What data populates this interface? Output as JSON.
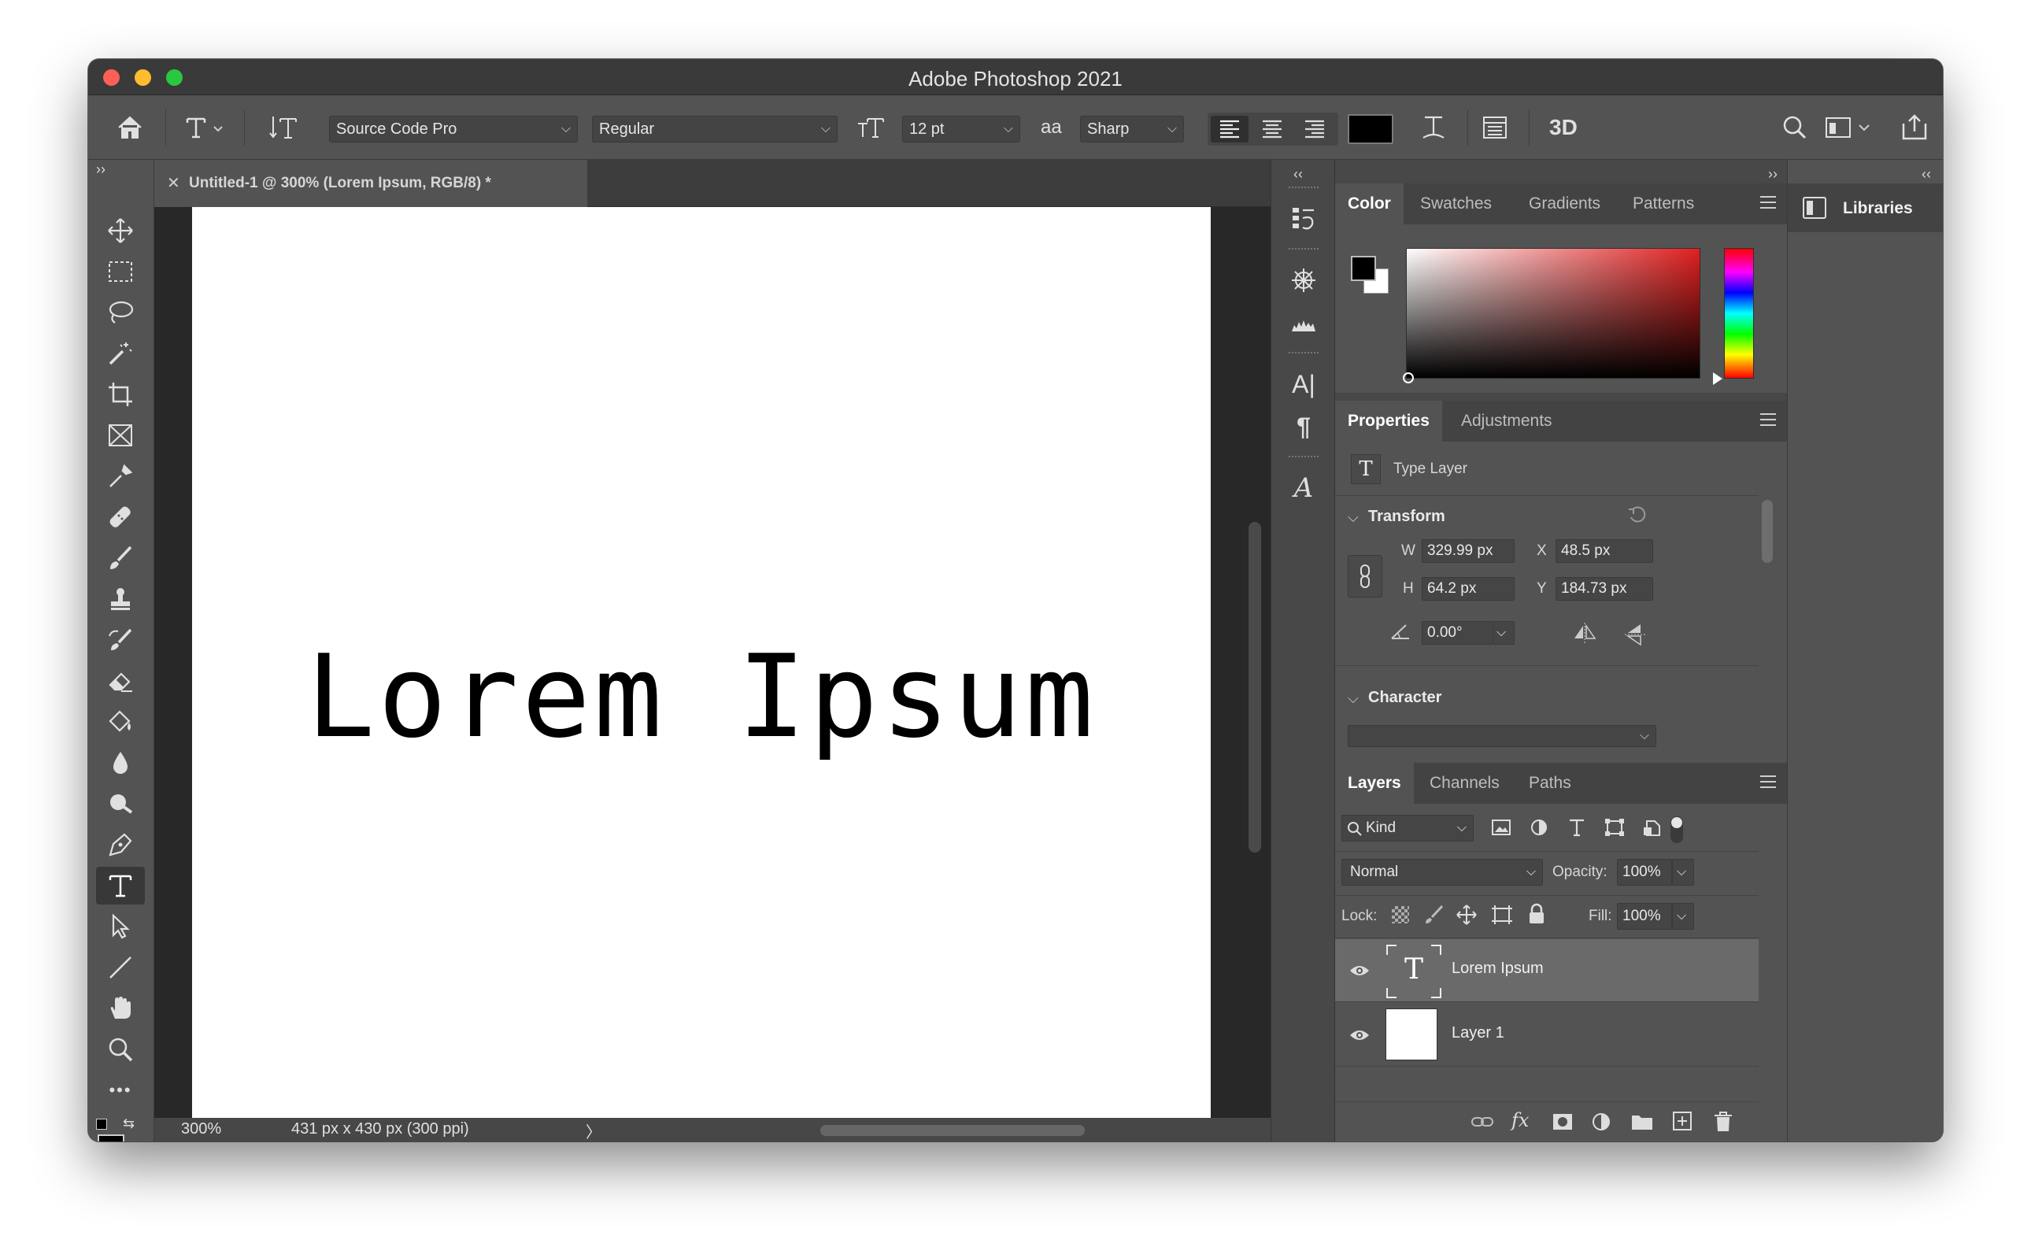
{
  "window": {
    "title": "Adobe Photoshop 2021"
  },
  "options_bar": {
    "font_family": "Source Code Pro",
    "font_style": "Regular",
    "font_size": "12 pt",
    "antialias_label": "aa",
    "antialias": "Sharp",
    "text_color": "#000000",
    "threed_label": "3D"
  },
  "document": {
    "tab_title": "Untitled-1 @ 300% (Lorem Ipsum, RGB/8) *",
    "canvas_text": "Lorem Ipsum",
    "zoom": "300%",
    "doc_size": "431 px x 430 px (300 ppi)",
    "status_arrow": "〉"
  },
  "collapse_labels": {
    "left": "››",
    "right": "‹‹"
  },
  "tools": [
    "move-tool",
    "marquee-tool",
    "lasso-tool",
    "magic-wand-tool",
    "crop-tool",
    "frame-tool",
    "eyedropper-tool",
    "healing-brush-tool",
    "brush-tool",
    "clone-stamp-tool",
    "history-brush-tool",
    "eraser-tool",
    "paint-bucket-tool",
    "blur-tool",
    "dodge-tool",
    "pen-tool",
    "type-tool",
    "path-selection-tool",
    "line-tool",
    "hand-tool",
    "zoom-tool",
    "more-tools"
  ],
  "active_tool": "type-tool",
  "tools_more_label": "•••",
  "color_panel": {
    "tabs": [
      "Color",
      "Swatches",
      "Gradients",
      "Patterns"
    ],
    "active_tab": "Color",
    "foreground": "#000000",
    "background": "#ffffff",
    "hue_color": "#e02020"
  },
  "properties_panel": {
    "tabs": [
      "Properties",
      "Adjustments"
    ],
    "layer_type": "Type Layer",
    "type_icon": "T",
    "transform_title": "Transform",
    "w_label": "W",
    "w_value": "329.99 px",
    "h_label": "H",
    "h_value": "64.2 px",
    "x_label": "X",
    "x_value": "48.5 px",
    "y_label": "Y",
    "y_value": "184.73 px",
    "angle_value": "0.00°",
    "character_title": "Character"
  },
  "layers_panel": {
    "tabs": [
      "Layers",
      "Channels",
      "Paths"
    ],
    "filter_kind": "Kind",
    "blend_mode": "Normal",
    "opacity_label": "Opacity:",
    "opacity": "100%",
    "lock_label": "Lock:",
    "fill_label": "Fill:",
    "fill": "100%",
    "layers": [
      {
        "name": "Lorem Ipsum",
        "kind": "text",
        "selected": true
      },
      {
        "name": "Layer 1",
        "kind": "pixel",
        "selected": false
      }
    ],
    "text_thumb_label": "T",
    "footer_fx_label": "fx"
  },
  "icon_strip": {
    "character_icon_label": "A|",
    "paragraph_icon_label": "¶",
    "glyphs_icon_label": "A"
  },
  "libraries": {
    "label": "Libraries"
  }
}
